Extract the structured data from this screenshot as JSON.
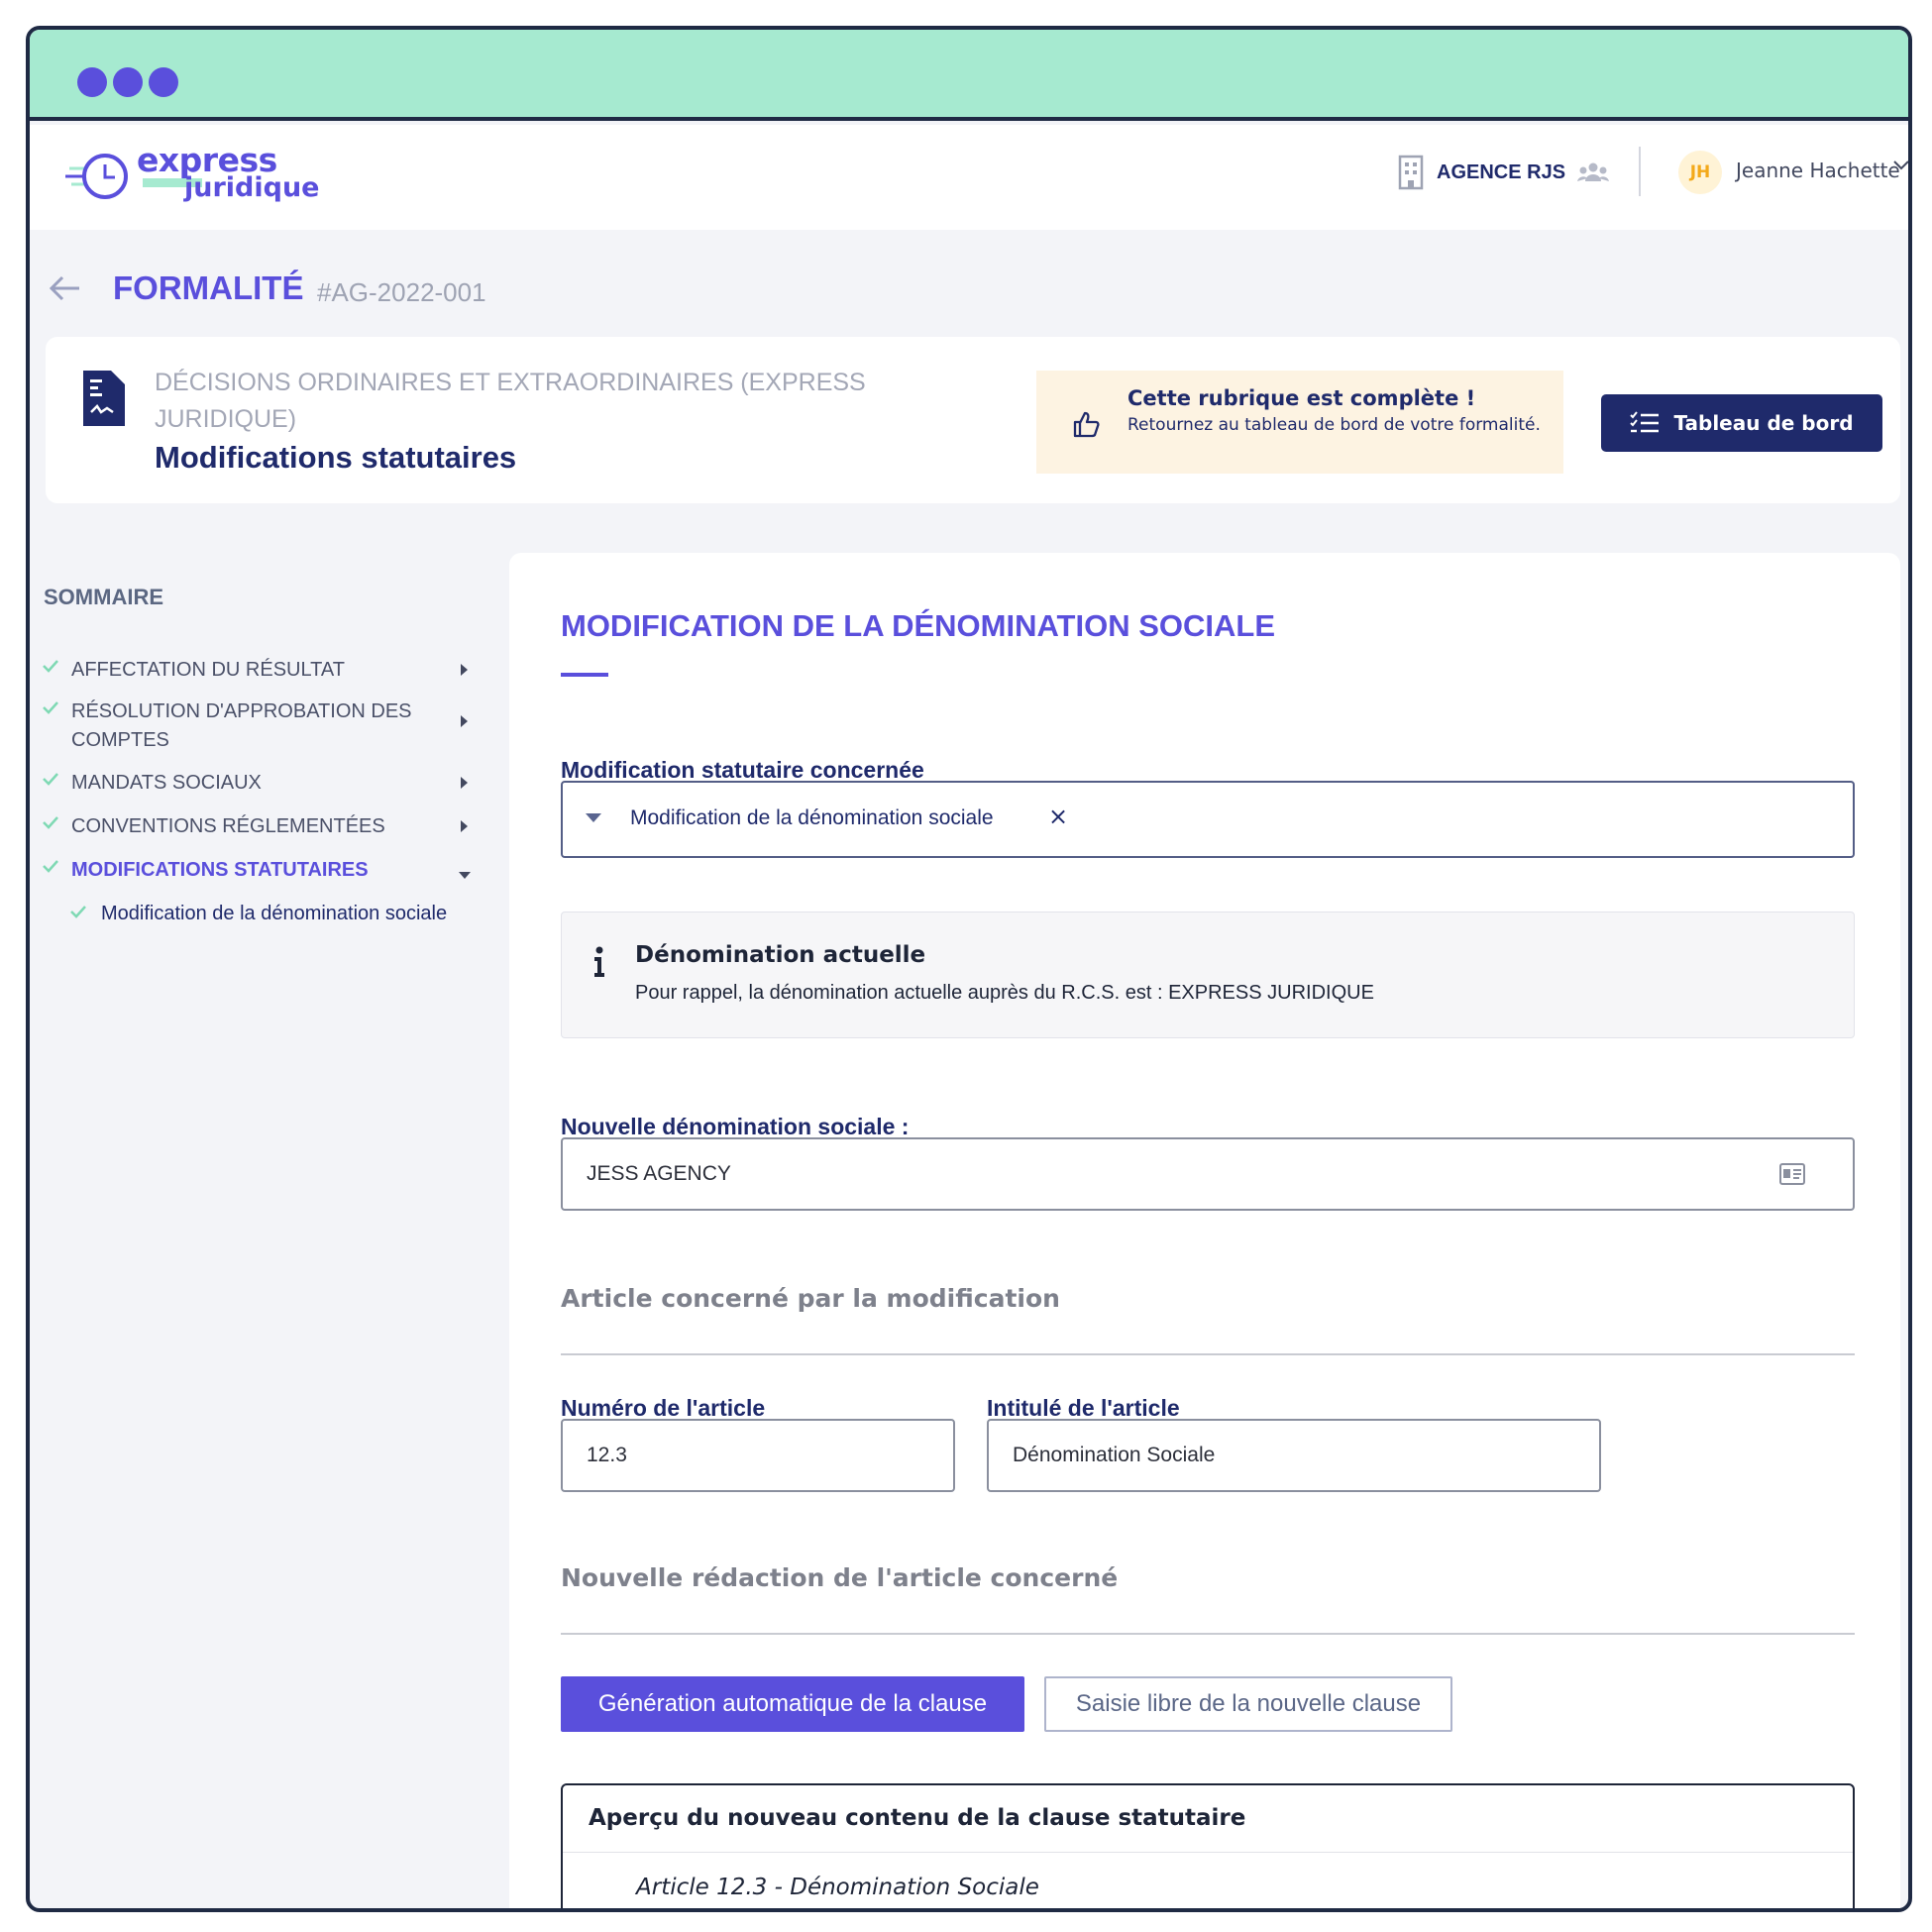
{
  "colors": {
    "titlebar": "#a6ead0",
    "accent": "#5a4fdc",
    "navy": "#1f2a6b",
    "check_green": "#7fd9b4",
    "notice_bg": "#fdf3e2",
    "avatar_text": "#f3a91a"
  },
  "brand": {
    "line1": "express",
    "line2": "juridique",
    "icon": "clock-logo-icon"
  },
  "topbar": {
    "agency_icon": "building-icon",
    "agency_name": "AGENCE RJS",
    "team_icon": "team-icon",
    "avatar_initials": "JH",
    "user_name": "Jeanne Hachette",
    "menu_icon": "chevron-down-icon"
  },
  "header": {
    "back_icon": "arrow-left-icon",
    "title": "FORMALITÉ",
    "reference": "#AG-2022-001"
  },
  "section": {
    "icon": "document-signature-icon",
    "kicker": "DÉCISIONS ORDINAIRES ET EXTRAORDINAIRES (EXPRESS JURIDIQUE)",
    "title": "Modifications statutaires",
    "notice": {
      "icon": "thumbs-up-icon",
      "title": "Cette rubrique est complète !",
      "text": "Retournez au tableau de bord de votre formalité."
    },
    "dashboard_button": {
      "icon": "checklist-icon",
      "label": "Tableau de bord"
    }
  },
  "sidebar": {
    "heading": "SOMMAIRE",
    "items": [
      {
        "label": "AFFECTATION DU RÉSULTAT",
        "state": "complete",
        "expanded": false
      },
      {
        "label": "RÉSOLUTION D'APPROBATION DES COMPTES",
        "state": "complete",
        "expanded": false
      },
      {
        "label": "MANDATS SOCIAUX",
        "state": "complete",
        "expanded": false
      },
      {
        "label": "CONVENTIONS RÉGLEMENTÉES",
        "state": "complete",
        "expanded": false
      },
      {
        "label": "MODIFICATIONS STATUTAIRES",
        "state": "complete",
        "expanded": true
      }
    ],
    "sub_items": [
      {
        "label": "Modification de la dénomination sociale",
        "state": "complete"
      }
    ]
  },
  "main": {
    "title": "MODIFICATION DE LA DÉNOMINATION SOCIALE",
    "modification_label": "Modification statutaire concernée",
    "selected_modification": "Modification de la dénomination sociale",
    "remove_symbol": "×",
    "info": {
      "icon": "info-icon",
      "title": "Dénomination actuelle",
      "text": "Pour rappel, la dénomination actuelle auprès du R.C.S. est : EXPRESS JURIDIQUE"
    },
    "new_name_label": "Nouvelle dénomination sociale :",
    "new_name_value": "JESS AGENCY",
    "new_name_icon": "id-card-icon",
    "article_heading": "Article concerné par la modification",
    "article_number_label": "Numéro de l'article",
    "article_number_value": "12.3",
    "article_title_label": "Intitulé de l'article",
    "article_title_value": "Dénomination Sociale",
    "redaction_heading": "Nouvelle rédaction de l'article concerné",
    "auto_button": "Génération automatique de la clause",
    "manual_button": "Saisie libre de la nouvelle clause",
    "preview_title": "Aperçu du nouveau contenu de la clause statutaire",
    "preview_article": "Article 12.3 - Dénomination Sociale"
  }
}
